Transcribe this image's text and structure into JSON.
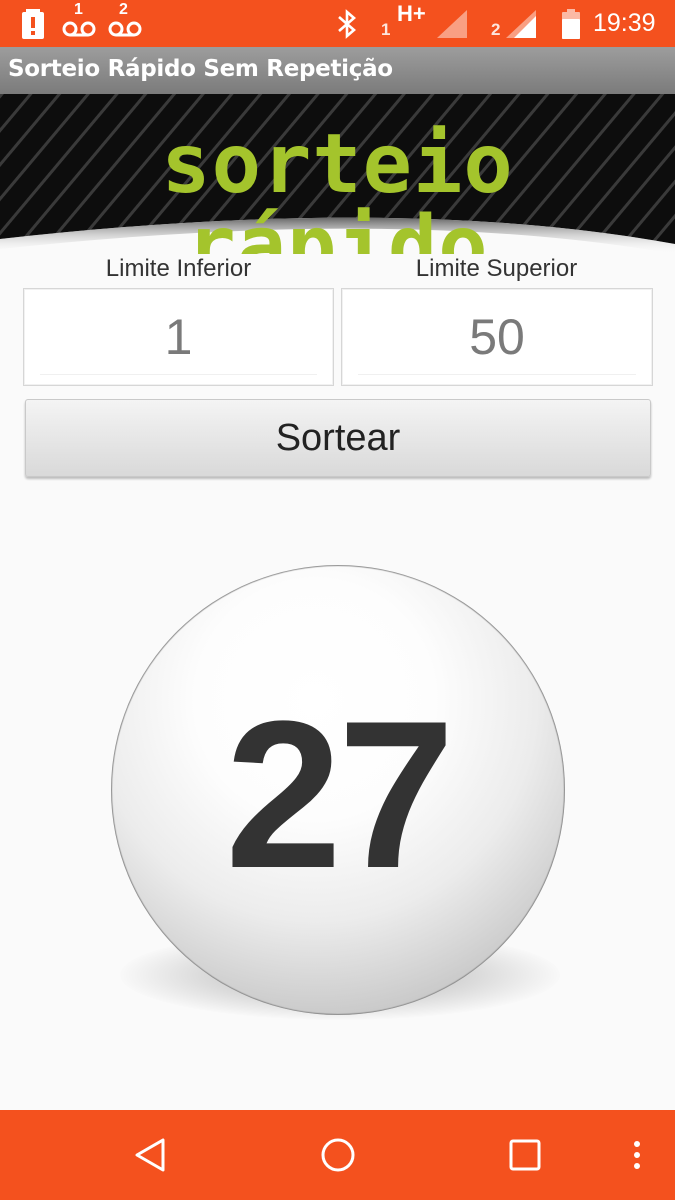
{
  "status_bar": {
    "time": "19:39",
    "network_type": "H+",
    "sim1_label": "1",
    "sim2_label": "2",
    "voicemail1_badge": "1",
    "voicemail2_badge": "2",
    "icons": [
      "alert-icon",
      "voicemail-icon",
      "voicemail-icon",
      "bluetooth-icon",
      "signal-icon",
      "signal-icon",
      "battery-icon"
    ]
  },
  "app": {
    "title": "Sorteio Rápido Sem Repetição",
    "banner_text": "sorteio rápido"
  },
  "limits": {
    "lower_label": "Limite Inferior",
    "lower_value": "1",
    "upper_label": "Limite Superior",
    "upper_value": "50"
  },
  "draw_button": {
    "label": "Sortear"
  },
  "result": {
    "number": "27"
  },
  "nav_bar": {
    "icons": [
      "back-icon",
      "home-icon",
      "recents-icon",
      "menu-icon"
    ]
  },
  "colors": {
    "accent": "#f4511e",
    "banner_text": "#a4c42c",
    "banner_bg": "#111111",
    "title_bar": "#8a8a8a"
  }
}
